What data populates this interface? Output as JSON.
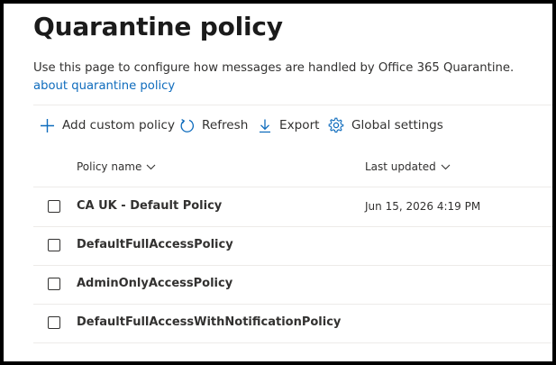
{
  "page": {
    "title": "Quarantine policy",
    "description": "Use this page to configure how messages are handled by Office 365 Quarantine.",
    "link_text": "about quarantine policy"
  },
  "toolbar": {
    "add_label": "Add custom policy",
    "refresh_label": "Refresh",
    "export_label": "Export",
    "settings_label": "Global settings",
    "add_icon": "plus-icon",
    "refresh_icon": "refresh-icon",
    "export_icon": "download-icon",
    "settings_icon": "gear-icon"
  },
  "table": {
    "columns": [
      "Policy name",
      "Last updated"
    ],
    "sort_icon": "chevron-down-icon",
    "rows": [
      {
        "name": "CA UK - Default Policy",
        "last_updated": "Jun 15, 2026 4:19 PM"
      },
      {
        "name": "DefaultFullAccessPolicy",
        "last_updated": ""
      },
      {
        "name": "AdminOnlyAccessPolicy",
        "last_updated": ""
      },
      {
        "name": "DefaultFullAccessWithNotificationPolicy",
        "last_updated": ""
      }
    ]
  },
  "colors": {
    "accent": "#0f6cbd",
    "text": "#323130",
    "divider": "#edebe9"
  }
}
